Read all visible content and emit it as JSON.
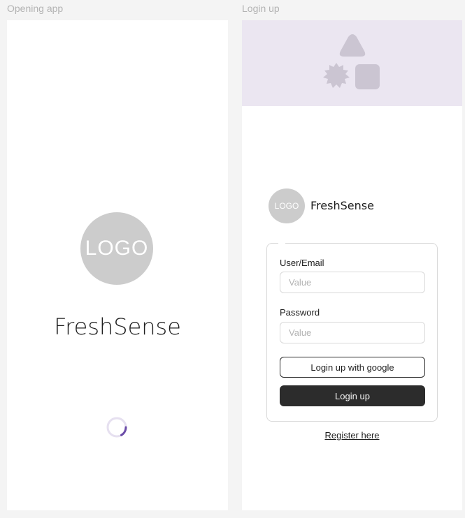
{
  "frames": {
    "splash_label": "Opening app",
    "login_label": "Login up"
  },
  "splash": {
    "logo_text": "LOGO",
    "app_name": "FreshSense"
  },
  "login": {
    "logo_text": "LOGO",
    "app_name": "FreshSense",
    "user_label": "User/Email",
    "user_placeholder": "Value",
    "password_label": "Password",
    "password_placeholder": "Value",
    "google_button": "Login up with google",
    "login_button": "Login up",
    "register_link": "Register here"
  },
  "colors": {
    "hero_bg": "#ebe6f1",
    "hero_shapes": "#cbc5d2",
    "spinner_accent": "#6b4ca8",
    "spinner_track": "#e6e0f0",
    "primary_button": "#2c2c2c"
  },
  "icons": [
    "placeholder-shapes-icon",
    "loading-spinner-icon"
  ]
}
